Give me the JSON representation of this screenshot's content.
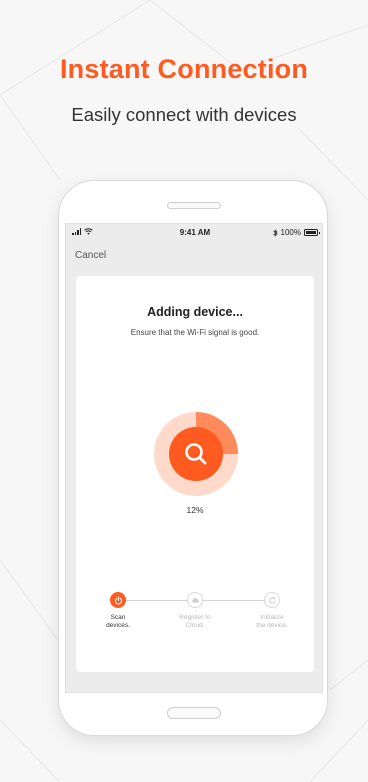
{
  "headline": "Instant Connection",
  "subheadline": "Easily connect with devices",
  "colors": {
    "accent": "#ff5a1f",
    "accent_light": "#ffd9c9",
    "accent_mid": "#ff8a5c"
  },
  "status_bar": {
    "time": "9:41 AM",
    "battery": "100%"
  },
  "nav": {
    "cancel_label": "Cancel"
  },
  "card": {
    "title": "Adding device...",
    "subtitle": "Ensure that the Wi-Fi signal is good.",
    "progress": 12,
    "progress_label": "12%"
  },
  "steps": [
    {
      "line1": "Scan",
      "line2": "devices.",
      "state": "active",
      "icon": "power-icon"
    },
    {
      "line1": "Register to",
      "line2": "Cloud.",
      "state": "inactive",
      "icon": "cloud-icon"
    },
    {
      "line1": "Initialize",
      "line2": "the device.",
      "state": "inactive",
      "icon": "refresh-icon"
    }
  ]
}
